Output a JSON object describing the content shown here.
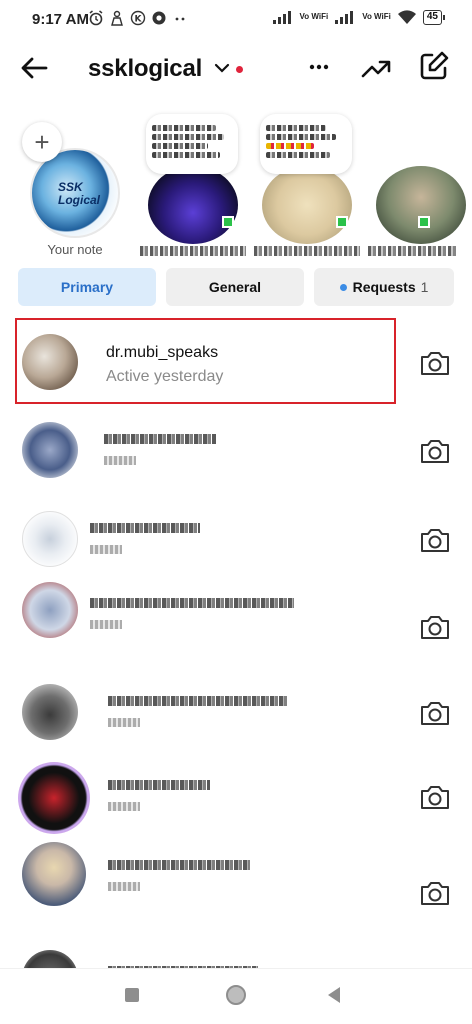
{
  "status_bar": {
    "time": "9:17 AM",
    "network_1": "Vo WiFi",
    "network_2": "Vo WiFi",
    "battery": "45"
  },
  "header": {
    "account_name": "ssklogical",
    "icons": [
      "back-arrow-icon",
      "chevron-down-icon",
      "more-icon",
      "trending-icon",
      "edit-icon"
    ]
  },
  "notes": {
    "self": {
      "logo_text": "SSK Logical",
      "label": "Your note"
    }
  },
  "tabs": {
    "primary": "Primary",
    "general": "General",
    "requests": "Requests",
    "requests_count": "1"
  },
  "threads": [
    {
      "name": "dr.mubi_speaks",
      "subtitle": "Active yesterday"
    }
  ],
  "colors": {
    "accent_blue": "#2a6fc8",
    "tab_primary_bg": "#dcecfb",
    "highlight_red": "#d8232a",
    "online_green": "#2bc24a",
    "notification_red": "#e0243c"
  }
}
